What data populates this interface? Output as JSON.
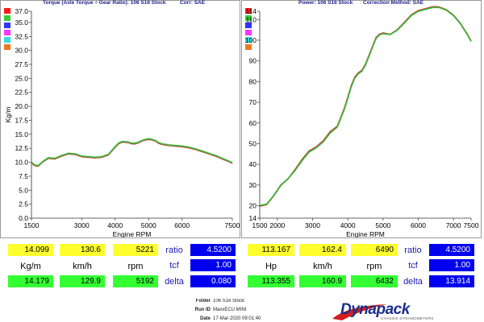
{
  "left_header": {
    "title": "Torque (Axle Torque ÷ Gear Ratio): 106 S16 Stock",
    "corr": "Corr: SAE"
  },
  "right_header": {
    "power": "Power: 106 S16 Stock",
    "correction": "Correction Method: SAE"
  },
  "legend_swatches": [
    "#ff1a1a",
    "#33cc33",
    "#3333ff",
    "#ff33ff",
    "#33dddd",
    "#ee7722"
  ],
  "chart_data": [
    {
      "type": "line",
      "xlabel": "Engine RPM",
      "ylabel": "Kg/m",
      "xlim": [
        1500,
        7500
      ],
      "ylim": [
        0,
        37
      ],
      "x_ticks": [
        1500,
        3000,
        4000,
        5000,
        6000,
        7500
      ],
      "y_ticks": [
        "0.0",
        "2.5",
        "5.0",
        "7.5",
        "10.0",
        "12.5",
        "15.0",
        "17.5",
        "20.0",
        "22.5",
        "25.0",
        "27.5",
        "30.0",
        "32.5",
        "35.0",
        "37.0"
      ],
      "grid": false,
      "series": [
        {
          "color": "#d42020",
          "x": [
            1500,
            1600,
            1700,
            1850,
            2000,
            2200,
            2400,
            2600,
            2800,
            3000,
            3200,
            3400,
            3600,
            3800,
            4000,
            4100,
            4200,
            4300,
            4400,
            4500,
            4600,
            4700,
            4800,
            4900,
            5000,
            5100,
            5200,
            5300,
            5400,
            5500,
            5600,
            5800,
            6000,
            6200,
            6400,
            6600,
            6800,
            7000,
            7200,
            7400,
            7500
          ],
          "values": [
            9.9,
            9.4,
            9.3,
            10.1,
            10.7,
            10.6,
            11.1,
            11.5,
            11.4,
            11.0,
            10.9,
            10.8,
            10.9,
            11.3,
            12.7,
            13.3,
            13.6,
            13.6,
            13.5,
            13.3,
            13.3,
            13.5,
            13.8,
            14.0,
            14.1,
            14.0,
            13.8,
            13.4,
            13.2,
            13.1,
            13.0,
            12.9,
            12.8,
            12.6,
            12.3,
            11.9,
            11.5,
            11.1,
            10.6,
            10.1,
            9.8
          ]
        },
        {
          "color": "#3cb83c",
          "x": [
            1500,
            1600,
            1700,
            1850,
            2000,
            2200,
            2400,
            2600,
            2800,
            3000,
            3200,
            3400,
            3600,
            3800,
            4000,
            4100,
            4200,
            4300,
            4400,
            4500,
            4600,
            4700,
            4800,
            4900,
            5000,
            5100,
            5200,
            5300,
            5400,
            5500,
            5600,
            5800,
            6000,
            6200,
            6400,
            6600,
            6800,
            7000,
            7200,
            7400,
            7500
          ],
          "values": [
            10.0,
            9.5,
            9.4,
            10.2,
            10.8,
            10.7,
            11.2,
            11.6,
            11.5,
            11.1,
            11.0,
            10.9,
            11.0,
            11.4,
            12.8,
            13.4,
            13.7,
            13.7,
            13.6,
            13.4,
            13.4,
            13.6,
            13.9,
            14.1,
            14.2,
            14.1,
            13.9,
            13.5,
            13.3,
            13.2,
            13.1,
            13.0,
            12.9,
            12.7,
            12.4,
            12.0,
            11.6,
            11.2,
            10.7,
            10.2,
            9.9
          ]
        }
      ]
    },
    {
      "type": "line",
      "xlabel": "Engine RPM",
      "ylabel": "Hp",
      "xlim": [
        1500,
        7500
      ],
      "ylim": [
        14,
        114
      ],
      "x_ticks": [
        1500,
        2000,
        3000,
        4000,
        5000,
        6000,
        7000,
        7500
      ],
      "y_ticks": [
        "14",
        "20",
        "30",
        "40",
        "50",
        "60",
        "70",
        "80",
        "90",
        "100",
        "110",
        "114"
      ],
      "grid": false,
      "series": [
        {
          "color": "#d42020",
          "x": [
            1500,
            1700,
            1900,
            2100,
            2300,
            2500,
            2700,
            2900,
            3100,
            3300,
            3500,
            3700,
            3900,
            4000,
            4100,
            4200,
            4300,
            4400,
            4500,
            4600,
            4700,
            4800,
            4900,
            5000,
            5100,
            5200,
            5400,
            5600,
            5800,
            6000,
            6200,
            6400,
            6500,
            6600,
            6800,
            7000,
            7200,
            7400,
            7500
          ],
          "values": [
            19.8,
            20.6,
            24.9,
            29.9,
            32.9,
            37.4,
            42.3,
            46.4,
            48.4,
            51.3,
            55.7,
            58.4,
            67.0,
            72.4,
            78.1,
            82.2,
            84.2,
            85.4,
            88.4,
            92.6,
            96.9,
            101.2,
            102.9,
            103.5,
            103.2,
            102.8,
            105.0,
            108.5,
            112.2,
            114.3,
            115.2,
            116.1,
            116.2,
            116.0,
            114.7,
            112.1,
            108.1,
            102.7,
            99.6
          ]
        },
        {
          "color": "#3cb83c",
          "x": [
            1500,
            1700,
            1900,
            2100,
            2300,
            2500,
            2700,
            2900,
            3100,
            3300,
            3500,
            3700,
            3900,
            4000,
            4100,
            4200,
            4300,
            4400,
            4500,
            4600,
            4700,
            4800,
            4900,
            5000,
            5100,
            5200,
            5400,
            5600,
            5800,
            6000,
            6200,
            6400,
            6500,
            6600,
            6800,
            7000,
            7200,
            7400,
            7500
          ],
          "values": [
            20.1,
            20.8,
            25.1,
            30.1,
            33.0,
            37.0,
            41.8,
            45.9,
            48.0,
            50.8,
            55.2,
            58.0,
            66.5,
            71.9,
            77.6,
            81.8,
            83.8,
            85.0,
            88.0,
            92.2,
            96.5,
            100.8,
            102.6,
            103.2,
            103.0,
            102.7,
            104.8,
            108.2,
            111.9,
            114.0,
            114.9,
            115.8,
            115.9,
            115.8,
            114.5,
            111.9,
            107.9,
            102.5,
            99.4
          ]
        }
      ]
    }
  ],
  "left_panel": {
    "row1": {
      "ratio_value": "14.099",
      "kmh": "130.6",
      "rpm": "5221",
      "ratio": "4.5200"
    },
    "labels": {
      "unit": "Kg/m",
      "kmh": "km/h",
      "rpm": "rpm",
      "ratio": "ratio",
      "tcf": "tcf",
      "delta": "delta"
    },
    "tcf": "1.00",
    "row3": {
      "value": "14.179",
      "kmh": "129.9",
      "rpm": "5192",
      "delta": "0.080"
    }
  },
  "right_panel": {
    "row1": {
      "value": "113.167",
      "kmh": "162.4",
      "rpm": "6490",
      "ratio": "4.5200"
    },
    "labels": {
      "unit": "Hp",
      "kmh": "km/h",
      "rpm": "rpm",
      "ratio": "ratio",
      "tcf": "tcf",
      "delta": "delta"
    },
    "tcf": "1.00",
    "row3": {
      "value": "113.355",
      "kmh": "160.9",
      "rpm": "6432",
      "delta": "13.914"
    }
  },
  "info": {
    "folder_label": "Folder",
    "folder": "106 S16 Stock",
    "run_label": "Run ID",
    "run": "MaxxECU MINI",
    "date_label": "Date",
    "date": "17-Mar-2020 09:01:40"
  },
  "logo": {
    "text": "Dynapack",
    "subtitle": "CHASSIS DYNAMOMETERS"
  }
}
